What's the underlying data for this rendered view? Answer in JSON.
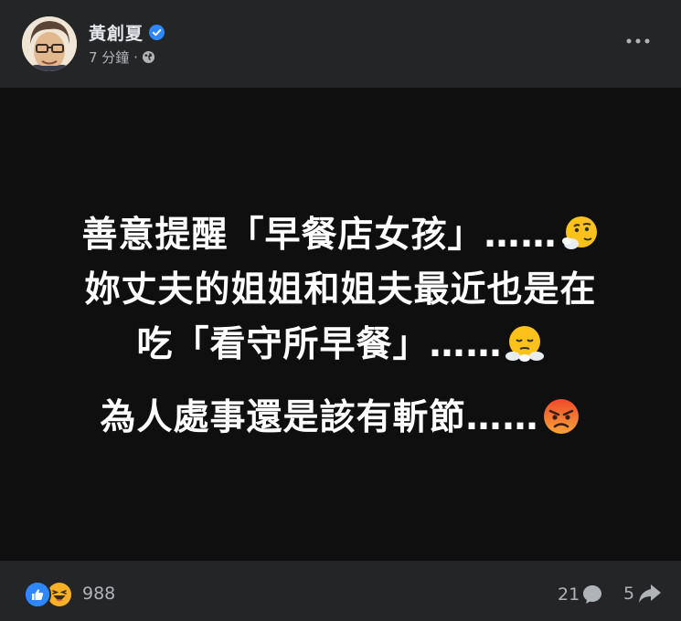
{
  "post": {
    "author": "黃創夏",
    "time": "7 分鐘 ·",
    "lines": [
      {
        "text": "善意提醒「早餐店女孩」……",
        "emoji": "thinking-smoking-face"
      },
      {
        "text": "妳丈夫的姐姐和姐夫最近也是在",
        "emoji": ""
      },
      {
        "text": "吃「看守所早餐」……",
        "emoji": "face-with-steam"
      },
      {
        "text": "為人處事還是該有斬節……",
        "emoji": "angry-face"
      }
    ],
    "icons": {
      "verified": "verified-badge-icon",
      "privacy": "globe-icon",
      "more": "more-options-icon"
    }
  },
  "footer": {
    "reaction_count": "988",
    "comment_count": "21",
    "share_count": "5",
    "reactions": [
      "like-icon",
      "haha-icon"
    ]
  },
  "colors": {
    "accent": "#2d88ff",
    "card": "#242526",
    "post_bg": "#0f0f10",
    "muted": "#b0b3b8"
  }
}
